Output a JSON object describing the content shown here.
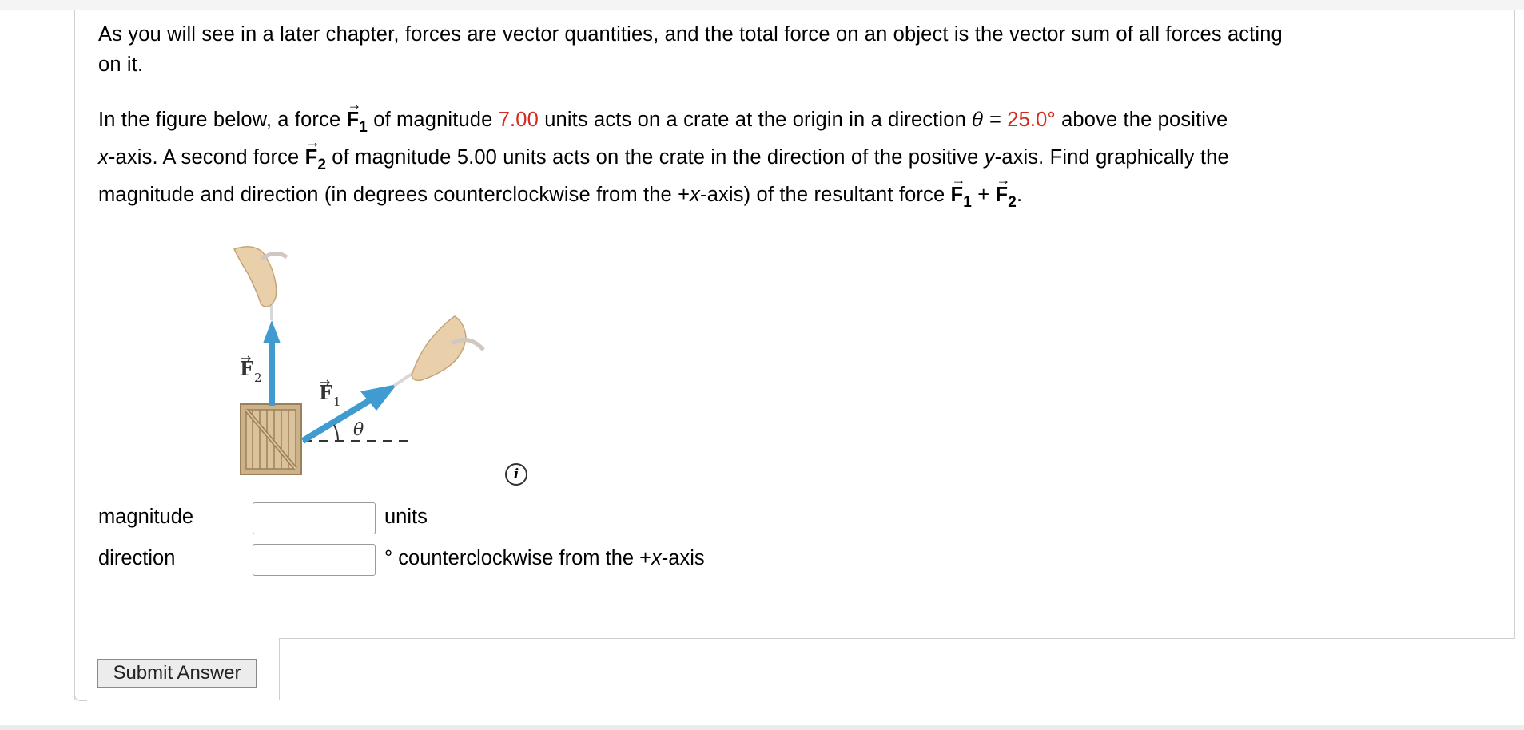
{
  "question": {
    "intro": "As you will see in a later chapter, forces are vector quantities, and the total force on an object is the vector sum of all forces acting",
    "intro_cont": "on it.",
    "p2_a": "In the figure below, a force ",
    "f_symbol": "F",
    "sub1": "1",
    "sub2": "2",
    "p2_b": " of magnitude ",
    "magnitude_value": "7.00",
    "p2_c": " units acts on a crate at the origin in a direction ",
    "theta": "θ",
    "equals": " = ",
    "angle_value": "25.0°",
    "p2_d": " above the positive",
    "x_var": "x",
    "p3_a": "-axis. A second force ",
    "p3_b": " of magnitude 5.00 units acts on the crate in the direction of the positive ",
    "y_var": "y",
    "p3_c": "-axis. Find graphically the",
    "p4_a": "magnitude and direction (in degrees counterclockwise from the +",
    "p4_b": "-axis) of the resultant force ",
    "plus": " + ",
    "period": "."
  },
  "figure": {
    "label_f2": "F",
    "label_f2_sub": "2",
    "label_f1": "F",
    "label_f1_sub": "1",
    "label_theta": "θ",
    "colors": {
      "arrow": "#3f9bd0",
      "crate": "#cbb28b",
      "crate_edge": "#9c8058",
      "hand": "#e9cfaa"
    }
  },
  "info_icon": {
    "glyph": "i"
  },
  "answers": {
    "magnitude_label": "magnitude",
    "magnitude_unit": "units",
    "magnitude_value": "",
    "direction_label": "direction",
    "direction_unit_a": "° counterclockwise from the +",
    "direction_unit_x": "x",
    "direction_unit_b": "-axis",
    "direction_value": ""
  },
  "submit_label": "Submit Answer"
}
